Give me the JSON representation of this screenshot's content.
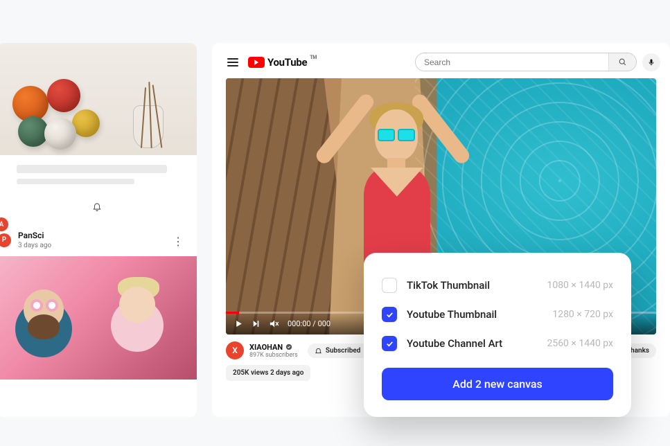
{
  "left": {
    "avatar_a": "A",
    "avatar_p": "P",
    "pansci_name": "PanSci",
    "pansci_sub": "3 days ago"
  },
  "yt": {
    "brand": "YouTube",
    "tm": "TM",
    "search_placeholder": "Search"
  },
  "video": {
    "time": "000:00 / 000",
    "avatar_x": "X",
    "channel": "XIAOHAN",
    "subs": "897K subscribers",
    "subscribed": "Subscribed",
    "thanks": "Thanks",
    "bottom_info": "205K views  2 days ago"
  },
  "popup": {
    "options": [
      {
        "label": "TikTok Thumbnail",
        "dims": "1080 × 1440 px",
        "checked": false
      },
      {
        "label": "Youtube Thumbnail",
        "dims": "1280 × 720 px",
        "checked": true
      },
      {
        "label": "Youtube Channel Art",
        "dims": "2560 × 1440 px",
        "checked": true
      }
    ],
    "button": "Add 2 new canvas"
  }
}
